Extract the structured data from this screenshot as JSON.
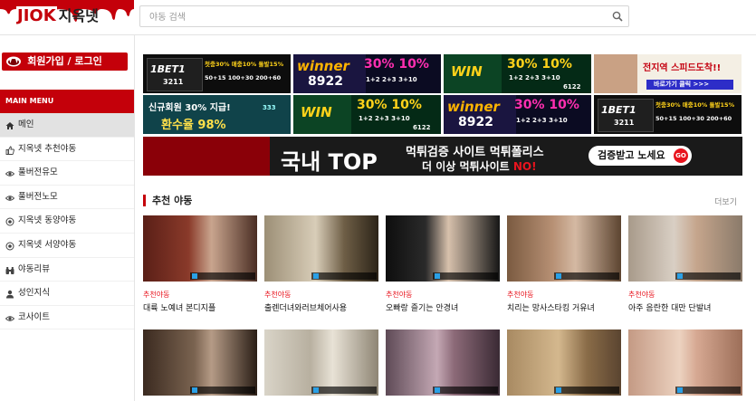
{
  "site": {
    "logo_en": "JIOK",
    "logo_ko": "지옥넷",
    "search_placeholder": "야동 검색"
  },
  "sidebar": {
    "login_label": "회원가입 / 로그인",
    "menu_title": "MAIN MENU",
    "items": [
      {
        "label": "메인",
        "icon": "home-icon"
      },
      {
        "label": "지옥넷 추천야동",
        "icon": "thumbs-up-icon"
      },
      {
        "label": "풀버전유모",
        "icon": "eye-icon"
      },
      {
        "label": "풀버전노모",
        "icon": "eye-icon"
      },
      {
        "label": "지옥넷 동양야동",
        "icon": "target-icon"
      },
      {
        "label": "지옥넷 서양야동",
        "icon": "target-icon"
      },
      {
        "label": "야동리뷰",
        "icon": "binoculars-icon"
      },
      {
        "label": "성인지식",
        "icon": "user-icon"
      },
      {
        "label": "코사이트",
        "icon": "eye-icon"
      }
    ]
  },
  "banners": [
    {
      "brand": "1BET1",
      "code": "3211",
      "main": "첫충30% 매충10% 돌발15%",
      "sub": "50+15 100+30 200+60"
    },
    {
      "brand": "winner",
      "code": "8922",
      "main": "30% 10%",
      "sub": "1+2 2+3 3+10"
    },
    {
      "brand": "WIN",
      "code": "6122",
      "main": "30% 10%",
      "sub": "1+2 2+3 3+10"
    },
    {
      "brand": "",
      "code": "",
      "main": "전지역 스피드도착!!",
      "sub": "바로가기 클릭 >>>"
    },
    {
      "brand": "",
      "code": "333",
      "main": "신규회원 30% 지급!",
      "sub": "환수율 98%"
    },
    {
      "brand": "WIN",
      "code": "6122",
      "main": "30% 10%",
      "sub": "1+2 2+3 3+10"
    },
    {
      "brand": "winner",
      "code": "8922",
      "main": "30% 10%",
      "sub": "1+2 2+3 3+10"
    },
    {
      "brand": "1BET1",
      "code": "3211",
      "main": "첫충30% 매충10% 돌발15%",
      "sub": "50+15 100+30 200+60"
    }
  ],
  "wide_banner": {
    "title": "국내 TOP",
    "line1": "먹튀검증 사이트 먹튀폴리스",
    "line2_prefix": "더 이상 먹튀사이트 ",
    "line2_emph": "NO!",
    "button": "검증받고 노세요",
    "button_go": "GO"
  },
  "section": {
    "title": "추천 야동",
    "more": "더보기"
  },
  "videos": [
    {
      "category": "추천야동",
      "title": "대륙 노예녀 본디지플"
    },
    {
      "category": "추천야동",
      "title": "출렌더녀와러브체어사용"
    },
    {
      "category": "추천야동",
      "title": "오빠랑 즐기는 안경녀"
    },
    {
      "category": "추천야동",
      "title": "치리는 망사스타킹 거유녀"
    },
    {
      "category": "추천야동",
      "title": "아주 음란한 대만 단발녀"
    },
    {
      "category": "",
      "title": ""
    },
    {
      "category": "",
      "title": ""
    },
    {
      "category": "",
      "title": ""
    },
    {
      "category": "",
      "title": ""
    },
    {
      "category": "",
      "title": ""
    }
  ],
  "colors": {
    "brand_red": "#c4000a",
    "accent_red": "#e8141e"
  }
}
